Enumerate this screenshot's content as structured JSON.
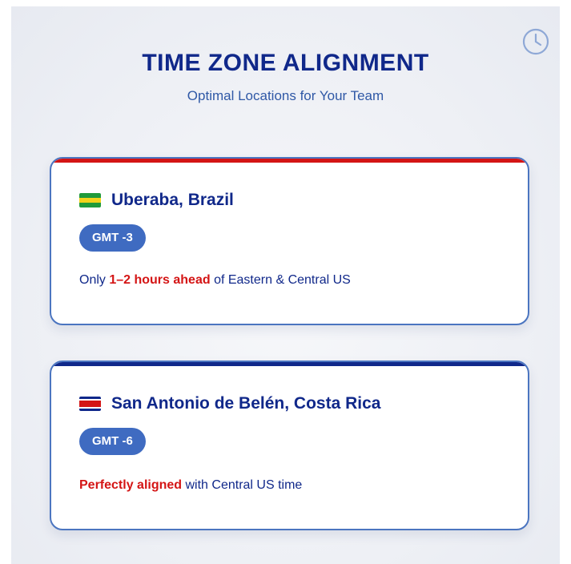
{
  "header": {
    "title": "TIME ZONE ALIGNMENT",
    "subtitle": "Optimal Locations for Your Team"
  },
  "icons": {
    "clock": "clock-icon",
    "flags": [
      "brazil-flag-icon",
      "costa-rica-flag-icon"
    ]
  },
  "colors": {
    "title": "#10288a",
    "accent_blue": "#3f6bc1",
    "highlight_red": "#d41515",
    "brazil_green": "#1f9a3a",
    "brazil_yellow": "#f2d31b",
    "costa_rica_red": "#d41515",
    "costa_rica_blue": "#10288a"
  },
  "locations": [
    {
      "city": "Uberaba, Brazil",
      "timezone": "GMT -3",
      "note_prefix": "Only ",
      "note_highlight": "1–2 hours ahead",
      "note_suffix": " of Eastern & Central US"
    },
    {
      "city": "San Antonio de Belén, Costa Rica",
      "timezone": "GMT -6",
      "note_prefix": "",
      "note_highlight": "Perfectly aligned",
      "note_suffix": " with Central US time"
    }
  ]
}
